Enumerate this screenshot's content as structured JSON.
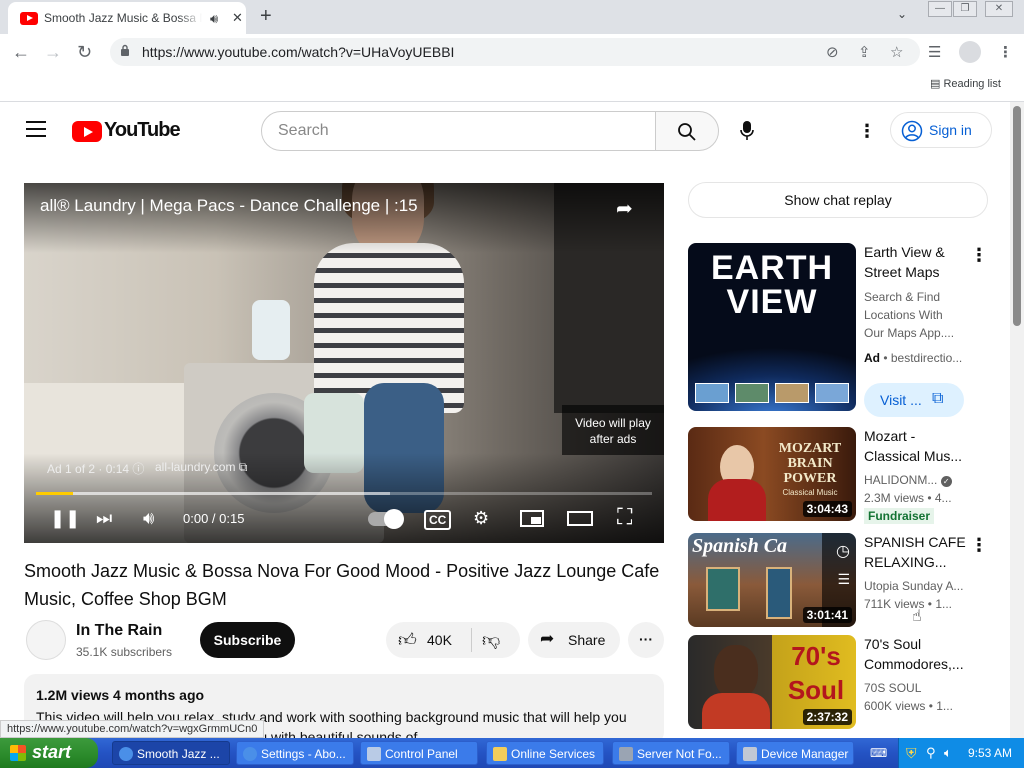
{
  "browser": {
    "tab_title": "Smooth Jazz Music & Bossa Nova For Good Mood - Positive Jazz Lounge Cafe Music",
    "url": "https://www.youtube.com/watch?v=UHaVoyUEBBI",
    "reading_list": "Reading list",
    "status_url": "https://www.youtube.com/watch?v=wgxGrmmUCn0"
  },
  "youtube": {
    "logo_text": "YouTube",
    "search_placeholder": "Search",
    "sign_in": "Sign in"
  },
  "player": {
    "ad_title": "all® Laundry | Mega Pacs - Dance Challenge | :15",
    "video_will_play": "Video will play after ads",
    "ad_counter": "Ad 1 of 2 · 0:14",
    "ad_site": "all-laundry.com",
    "time": "0:00 / 0:15",
    "progress_fraction": 0.06
  },
  "video": {
    "title": "Smooth Jazz Music & Bossa Nova For Good Mood - Positive Jazz Lounge Cafe Music, Coffee Shop BGM",
    "channel": "In The Rain",
    "subscribers": "35.1K subscribers",
    "subscribe": "Subscribe",
    "likes": "40K",
    "share": "Share",
    "views_age": "1.2M views  4 months ago",
    "description": "This video will help you relax, study and work with soothing background music that will help you enjoy relaxing scenery all around you with beautiful sounds of"
  },
  "sidebar": {
    "chat_replay": "Show chat replay",
    "ad": {
      "title": "Earth View & Street Maps",
      "desc": "Search & Find Locations With Our Maps App....",
      "ad_label": "Ad",
      "advertiser": "bestdirectio...",
      "visit": "Visit ...",
      "thumb_text": "EARTH VIEW"
    },
    "videos": [
      {
        "title": "Mozart - Classical Mus...",
        "channel": "HALIDONM...",
        "meta": "2.3M views  • 4...",
        "badge": "Fundraiser",
        "duration": "3:04:43",
        "thumb_text": "MOZART BRAIN POWER",
        "thumb_sub": "Classical Music"
      },
      {
        "title": "SPANISH CAFE RELAXING...",
        "channel": "Utopia Sunday A...",
        "meta": "711K views  • 1...",
        "duration": "3:01:41",
        "thumb_text": "Spanish Ca"
      },
      {
        "title": "70's Soul Commodores,...",
        "channel": "70S SOUL",
        "meta": "600K views  • 1...",
        "duration": "2:37:32",
        "thumb_text": "70's Soul"
      }
    ]
  },
  "taskbar": {
    "start": "start",
    "items": [
      "Smooth Jazz ...",
      "Settings - Abo...",
      "Control Panel",
      "Online Services",
      "Server Not Fo...",
      "Device Manager"
    ],
    "clock": "9:53 AM"
  }
}
